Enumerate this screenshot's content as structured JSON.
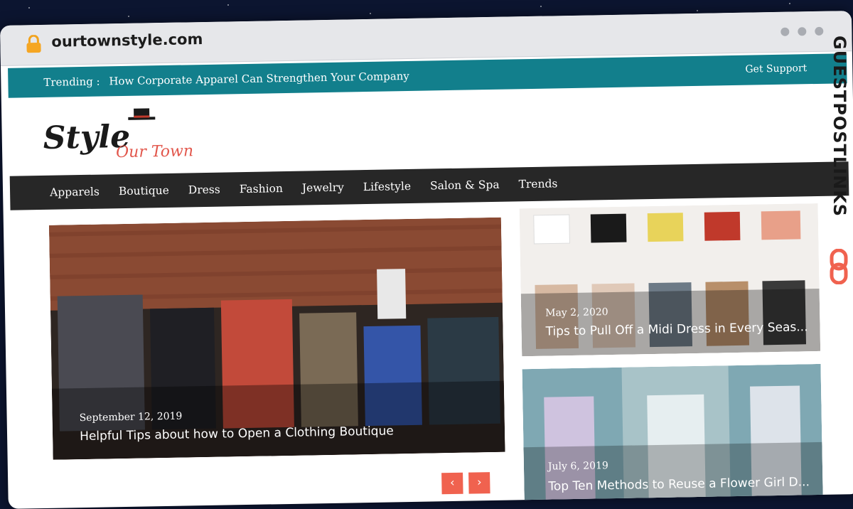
{
  "browser": {
    "url": "ourtownstyle.com"
  },
  "topbar": {
    "trending_label": "Trending :",
    "trending_text": "How Corporate Apparel Can Strengthen Your Company",
    "support": "Get Support"
  },
  "logo": {
    "word1": "Style",
    "word2": "Our Town"
  },
  "nav": [
    "Apparels",
    "Boutique",
    "Dress",
    "Fashion",
    "Jewelry",
    "Lifestyle",
    "Salon & Spa",
    "Trends"
  ],
  "hero": {
    "date": "September 12, 2019",
    "title": "Helpful Tips about how to Open a Clothing Boutique"
  },
  "side_posts": [
    {
      "date": "May 2, 2020",
      "title": "Tips to Pull Off a Midi Dress in Every Seas..."
    },
    {
      "date": "July 6, 2019",
      "title": "Top Ten Methods to Reuse a Flower Girl D..."
    }
  ],
  "slider": {
    "prev": "‹",
    "next": "›"
  },
  "banner": {
    "text": "GUESTPOSTLINKS"
  },
  "colors": {
    "topbar": "#127f8c",
    "nav": "#272727",
    "accent": "#f0624f"
  }
}
